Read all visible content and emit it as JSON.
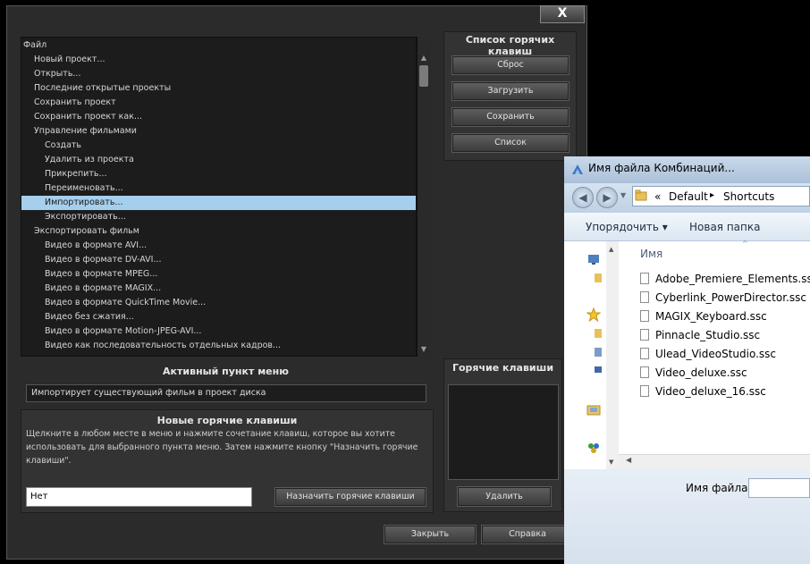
{
  "dialog": {
    "close_label": "X",
    "menu_items": [
      {
        "label": "Файл",
        "level": 0
      },
      {
        "label": "Новый проект...",
        "level": 1
      },
      {
        "label": "Открыть...",
        "level": 1
      },
      {
        "label": "Последние открытые проекты",
        "level": 1
      },
      {
        "label": "Сохранить проект",
        "level": 1
      },
      {
        "label": "Сохранить проект как...",
        "level": 1
      },
      {
        "label": "Управление фильмами",
        "level": 1
      },
      {
        "label": "Создать",
        "level": 2
      },
      {
        "label": "Удалить из проекта",
        "level": 2
      },
      {
        "label": "Прикрепить...",
        "level": 2
      },
      {
        "label": "Переименовать...",
        "level": 2
      },
      {
        "label": "Импортировать...",
        "level": 2,
        "selected": true
      },
      {
        "label": "Экспортировать...",
        "level": 2
      },
      {
        "label": "Экспортировать фильм",
        "level": 1
      },
      {
        "label": "Видео в формате AVI...",
        "level": 2
      },
      {
        "label": "Видео в формате DV-AVI...",
        "level": 2
      },
      {
        "label": "Видео в формате MPEG...",
        "level": 2
      },
      {
        "label": "Видео в формате MAGIX...",
        "level": 2
      },
      {
        "label": "Видео в формате QuickTime Movie...",
        "level": 2
      },
      {
        "label": "Видео без сжатия...",
        "level": 2
      },
      {
        "label": "Видео в формате Motion-JPEG-AVI...",
        "level": 2
      },
      {
        "label": "Видео как последовательность отдельных кадров...",
        "level": 2
      }
    ],
    "hotkey_list_title": "Список горячих клавиш",
    "reset_label": "Сброс",
    "load_label": "Загрузить",
    "save_label": "Сохранить",
    "list_label": "Список",
    "active_item_title": "Активный пункт меню",
    "active_item_value": "Импортирует существующий фильм в проект диска",
    "new_hotkeys_title": "Новые горячие клавиши",
    "hint_text": "Щелкните в любом месте в меню и нажмите сочетание клавиш, которое вы хотите использовать для выбранного пункта меню. Затем нажмите кнопку \"Назначить горячие клавиши\".",
    "hotkey_value": "Нет",
    "assign_label": "Назначить горячие клавиши",
    "hotkeys_title": "Горячие клавиши",
    "delete_label": "Удалить",
    "close_button_label": "Закрыть",
    "help_label": "Справка"
  },
  "explorer": {
    "title": "Имя файла Комбинаций...",
    "breadcrumb_prefix": "«",
    "breadcrumb_1": "Default",
    "breadcrumb_sep": "▸",
    "breadcrumb_2": "Shortcuts",
    "organize_label": "Упорядочить ▾",
    "new_folder_label": "Новая папка",
    "column_name": "Имя",
    "files": [
      "Adobe_Premiere_Elements.ssc",
      "Cyberlink_PowerDirector.ssc",
      "MAGIX_Keyboard.ssc",
      "Pinnacle_Studio.ssc",
      "Ulead_VideoStudio.ssc",
      "Video_deluxe.ssc",
      "Video_deluxe_16.ssc"
    ],
    "filename_label": "Имя файла:"
  }
}
